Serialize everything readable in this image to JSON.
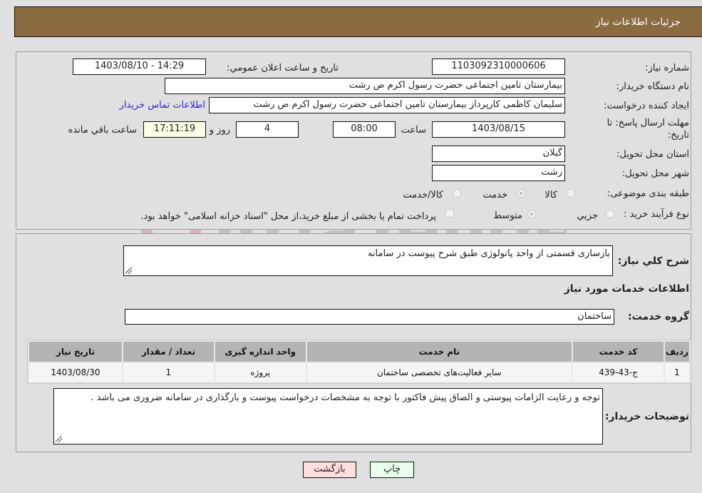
{
  "header": {
    "title": "جزئیات اطلاعات نیاز"
  },
  "details": {
    "need_number_label": "شماره نیاز:",
    "need_number": "1103092310000606",
    "announce_label": "تاریخ و ساعت اعلان عمومي:",
    "announce_value": "1403/08/10 - 14:29",
    "buyer_org_label": "نام دستگاه خریدار:",
    "buyer_org": "بیمارستان  تامین اجتماعی حضرت رسول اکرم ص رشت",
    "creator_label": "ایجاد کننده درخواست:",
    "creator": "سلیمان کاظمی کارپرداز بیمارستان  تامین اجتماعی حضرت رسول اکرم ص رشت",
    "contact_link": "اطلاعات تماس خریدار",
    "deadline_label_1": "مهلت ارسال پاسخ: تا",
    "deadline_label_2": "تاریخ:",
    "deadline_date": "1403/08/15",
    "time_label": "ساعت",
    "deadline_time": "08:00",
    "days_value": "4",
    "days_label": "روز و",
    "remaining_time": "17:11:19",
    "remaining_label": "ساعت باقي مانده",
    "province_label": "استان محل تحویل:",
    "province": "گیلان",
    "city_label": "شهر محل تحویل:",
    "city": "رشت",
    "category_label": "طبقه بندی موضوعی:",
    "category_options": [
      {
        "label": "کالا",
        "checked": false
      },
      {
        "label": "خدمت",
        "checked": true
      },
      {
        "label": "کالا/خدمت",
        "checked": false
      }
    ],
    "process_label": "نوع فرآیند خرید :",
    "process_options": [
      {
        "label": "جزيي",
        "checked": false
      },
      {
        "label": "متوسط",
        "checked": true
      }
    ],
    "treasury_checkbox_label": "پرداخت تمام یا بخشی از مبلغ خرید،از محل \"اسناد خزانه اسلامی\" خواهد بود.",
    "treasury_checked": false
  },
  "summary": {
    "description_label": "شرح كلي نیاز:",
    "description": "بازسازی قسمتی از واحد پاتولوژی طبق شرح پیوست در سامانه",
    "services_heading": "اطلاعات خدمات مورد نیاز",
    "service_group_label": "گروه خدمت:",
    "service_group": "ساختمان"
  },
  "table": {
    "headers": [
      "ردیف",
      "کد خدمت",
      "نام خدمت",
      "واحد اندازه گیری",
      "تعداد / مقدار",
      "تاریخ نیاز"
    ],
    "rows": [
      [
        "1",
        "ج-43-439",
        "سایر فعالیت‌های تخصصی ساختمان",
        "پروژه",
        "1",
        "1403/08/30"
      ]
    ]
  },
  "buyer_notes": {
    "label": "توضیحات خریدار:",
    "text": "توجه و رعایت الزامات پیوستی و الصاق پیش فاکتور با توجه به مشخصات درخواست پیوست و بارگذاری در سامانه ضروری می باشد ."
  },
  "buttons": {
    "print": "چاپ",
    "back": "بازگشت"
  },
  "colors": {
    "header_bg": "#8b6b40",
    "print_bg": "#eaffea",
    "back_bg": "#ffdede",
    "link": "#2a2ad0"
  },
  "watermark": "AriaTender.neT"
}
